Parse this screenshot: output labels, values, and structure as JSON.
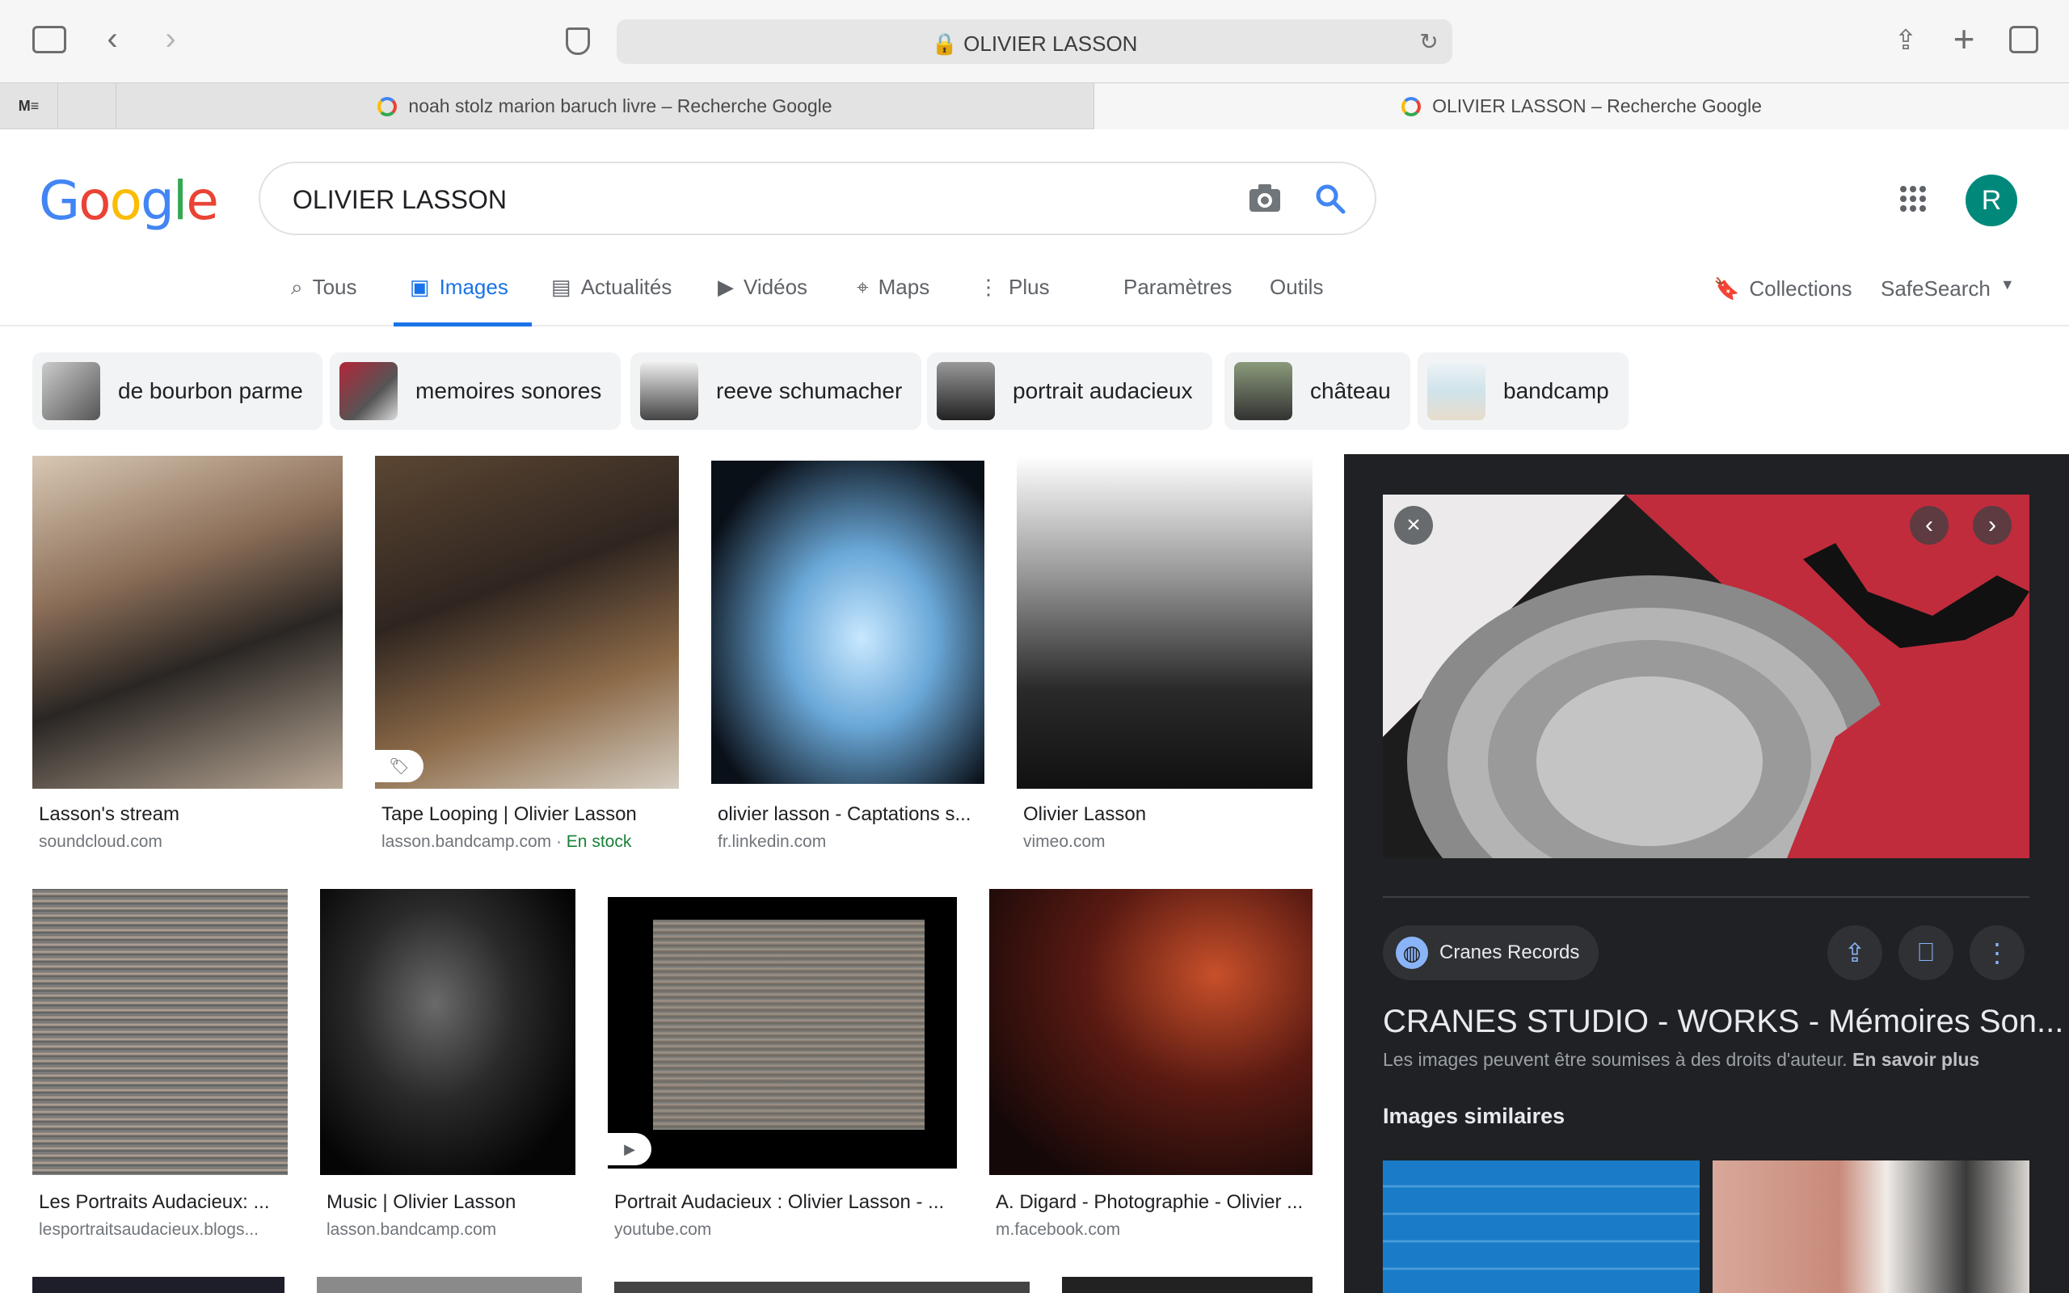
{
  "browser": {
    "url": "OLIVIER LASSON",
    "tabs": [
      {
        "label": "noah stolz marion baruch livre – Recherche Google"
      },
      {
        "label": "OLIVIER LASSON – Recherche Google"
      }
    ]
  },
  "google": {
    "logo": "Google",
    "query": "OLIVIER LASSON",
    "avatar_letter": "R",
    "nav": [
      "Tous",
      "Images",
      "Actualités",
      "Vidéos",
      "Maps",
      "Plus",
      "Paramètres",
      "Outils"
    ],
    "collections": "Collections",
    "safesearch": "SafeSearch"
  },
  "chips": [
    "de bourbon parme",
    "memoires sonores",
    "reeve schumacher",
    "portrait audacieux",
    "château",
    "bandcamp"
  ],
  "results": [
    {
      "title": "Lasson's stream",
      "source": "soundcloud.com"
    },
    {
      "title": "Tape Looping | Olivier Lasson",
      "source": "lasson.bandcamp.com",
      "badge": "En stock"
    },
    {
      "title": "olivier lasson - Captations s...",
      "source": "fr.linkedin.com"
    },
    {
      "title": "Olivier Lasson",
      "source": "vimeo.com"
    },
    {
      "title": "Les Portraits Audacieux: ...",
      "source": "lesportraitsaudacieux.blogs..."
    },
    {
      "title": "Music | Olivier Lasson",
      "source": "lasson.bandcamp.com"
    },
    {
      "title": "Portrait Audacieux : Olivier Lasson - ...",
      "source": "youtube.com"
    },
    {
      "title": "A. Digard - Photographie - Olivier ...",
      "source": "m.facebook.com"
    }
  ],
  "panel": {
    "source": "Cranes Records",
    "title": "CRANES STUDIO - WORKS - Mémoires Son...",
    "copyright": "Les images peuvent être soumises à des droits d'auteur.",
    "learn_more": "En savoir plus",
    "similar": "Images similaires"
  },
  "colors": {
    "accent": "#1a73e8",
    "panel_bg": "#202124",
    "avatar": "#00897b",
    "stock": "#188038"
  }
}
